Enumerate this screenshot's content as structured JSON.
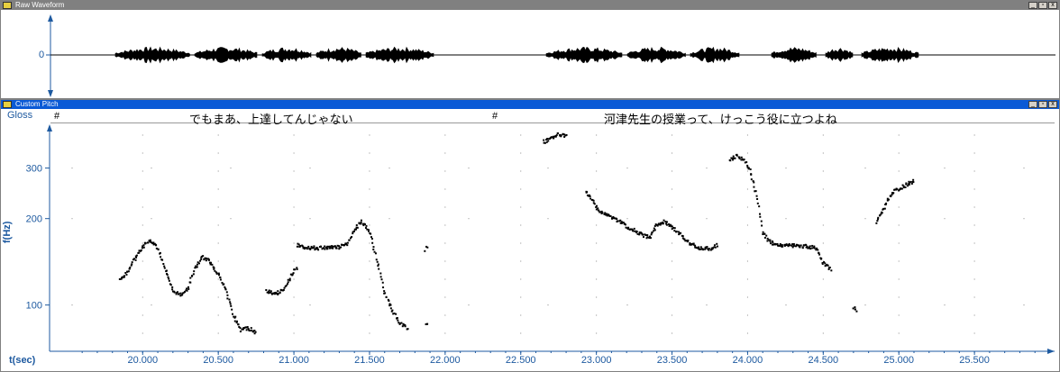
{
  "windows": {
    "waveform": {
      "title": "Raw Waveform"
    },
    "pitch": {
      "title": "Custom Pitch"
    }
  },
  "window_controls": {
    "minimize": "_",
    "restore": "▫",
    "close": "x"
  },
  "waveform_axis": {
    "zero_label": "0"
  },
  "gloss": {
    "label": "Gloss",
    "segments": [
      {
        "marker": "#",
        "text": "でもまあ、上達してんじゃない"
      },
      {
        "marker": "#",
        "text": "河津先生の授業って、けっこう役に立つよね"
      }
    ]
  },
  "pitch_axis": {
    "ylabel": "f(Hz)",
    "y_ticks": [
      "300",
      "200",
      "100"
    ],
    "xlabel": "t(sec)",
    "x_ticks": [
      "20.000",
      "20.500",
      "21.000",
      "21.500",
      "22.000",
      "22.500",
      "23.000",
      "23.500",
      "24.000",
      "24.500",
      "25.000",
      "25.500"
    ]
  },
  "colors": {
    "accent": "#1e5aa0",
    "title_active": "#0a5ad6",
    "title_inactive": "#808080"
  },
  "chart_data": {
    "type": "scatter",
    "xlabel": "t(sec)",
    "ylabel": "f(Hz)",
    "xlim": [
      19.45,
      26.0
    ],
    "ylim": [
      70,
      420
    ],
    "y_scale": "log",
    "segments": [
      [
        [
          19.85,
          122
        ],
        [
          19.9,
          130
        ],
        [
          19.95,
          145
        ],
        [
          20.0,
          160
        ],
        [
          20.05,
          168
        ],
        [
          20.1,
          158
        ],
        [
          20.15,
          132
        ],
        [
          20.2,
          112
        ],
        [
          20.25,
          108
        ],
        [
          20.3,
          115
        ],
        [
          20.35,
          135
        ],
        [
          20.4,
          147
        ],
        [
          20.45,
          140
        ],
        [
          20.5,
          128
        ],
        [
          20.55,
          112
        ],
        [
          20.6,
          92
        ],
        [
          20.65,
          82
        ],
        [
          20.7,
          83
        ],
        [
          20.75,
          80
        ]
      ],
      [
        [
          20.82,
          112
        ],
        [
          20.88,
          109
        ],
        [
          20.93,
          113
        ],
        [
          20.98,
          126
        ],
        [
          21.02,
          135
        ]
      ],
      [
        [
          21.02,
          162
        ],
        [
          21.1,
          158
        ],
        [
          21.2,
          158
        ],
        [
          21.3,
          159
        ],
        [
          21.35,
          162
        ],
        [
          21.4,
          182
        ],
        [
          21.45,
          195
        ],
        [
          21.5,
          180
        ],
        [
          21.55,
          142
        ],
        [
          21.6,
          110
        ],
        [
          21.65,
          96
        ],
        [
          21.7,
          86
        ],
        [
          21.75,
          83
        ]
      ],
      [
        [
          21.87,
          86
        ],
        [
          21.88,
          85
        ]
      ],
      [
        [
          21.87,
          155
        ],
        [
          21.88,
          160
        ]
      ],
      [
        [
          22.65,
          370
        ],
        [
          22.7,
          380
        ],
        [
          22.75,
          395
        ],
        [
          22.8,
          388
        ]
      ],
      [
        [
          22.93,
          250
        ],
        [
          22.97,
          232
        ],
        [
          23.02,
          212
        ],
        [
          23.07,
          205
        ],
        [
          23.12,
          200
        ],
        [
          23.2,
          188
        ],
        [
          23.3,
          176
        ],
        [
          23.35,
          172
        ],
        [
          23.4,
          190
        ],
        [
          23.45,
          195
        ],
        [
          23.5,
          186
        ],
        [
          23.55,
          178
        ],
        [
          23.6,
          166
        ],
        [
          23.68,
          158
        ],
        [
          23.75,
          157
        ],
        [
          23.8,
          162
        ]
      ],
      [
        [
          23.88,
          318
        ],
        [
          23.93,
          330
        ],
        [
          23.98,
          320
        ],
        [
          24.02,
          290
        ],
        [
          24.06,
          240
        ],
        [
          24.1,
          180
        ],
        [
          24.15,
          165
        ],
        [
          24.2,
          162
        ],
        [
          24.3,
          161
        ],
        [
          24.4,
          160
        ],
        [
          24.45,
          158
        ],
        [
          24.5,
          140
        ],
        [
          24.55,
          133
        ]
      ],
      [
        [
          24.7,
          98
        ],
        [
          24.72,
          95
        ]
      ],
      [
        [
          24.85,
          195
        ],
        [
          24.9,
          215
        ],
        [
          24.95,
          245
        ],
        [
          25.0,
          255
        ],
        [
          25.05,
          262
        ],
        [
          25.1,
          270
        ]
      ]
    ]
  }
}
